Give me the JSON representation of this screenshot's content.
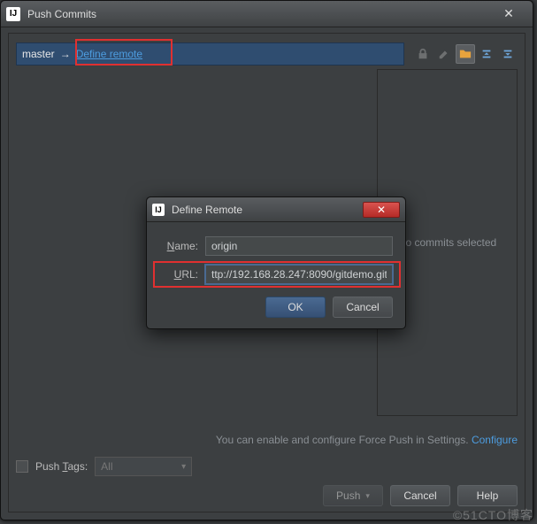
{
  "outer": {
    "title": "Push Commits",
    "close_label": "✕",
    "branch": {
      "name": "master",
      "arrow": "→",
      "define_remote_label": "Define remote"
    },
    "right_pane_placeholder": "No commits selected",
    "hint_text": "You can enable and configure Force Push in Settings. ",
    "hint_link": "Configure",
    "push_tags": {
      "label_pre": "Push ",
      "label_u": "T",
      "label_post": "ags:",
      "combo_value": "All"
    },
    "buttons": {
      "push": "Push",
      "cancel": "Cancel",
      "help": "Help"
    }
  },
  "inner": {
    "title": "Define Remote",
    "close_label": "✕",
    "fields": {
      "name_label_u": "N",
      "name_label_rest": "ame:",
      "name_value": "origin",
      "url_label_u": "U",
      "url_label_rest": "RL:",
      "url_value": "ttp://192.168.28.247:8090/gitdemo.git"
    },
    "buttons": {
      "ok": "OK",
      "cancel": "Cancel"
    }
  },
  "watermark": "©51CTO博客"
}
